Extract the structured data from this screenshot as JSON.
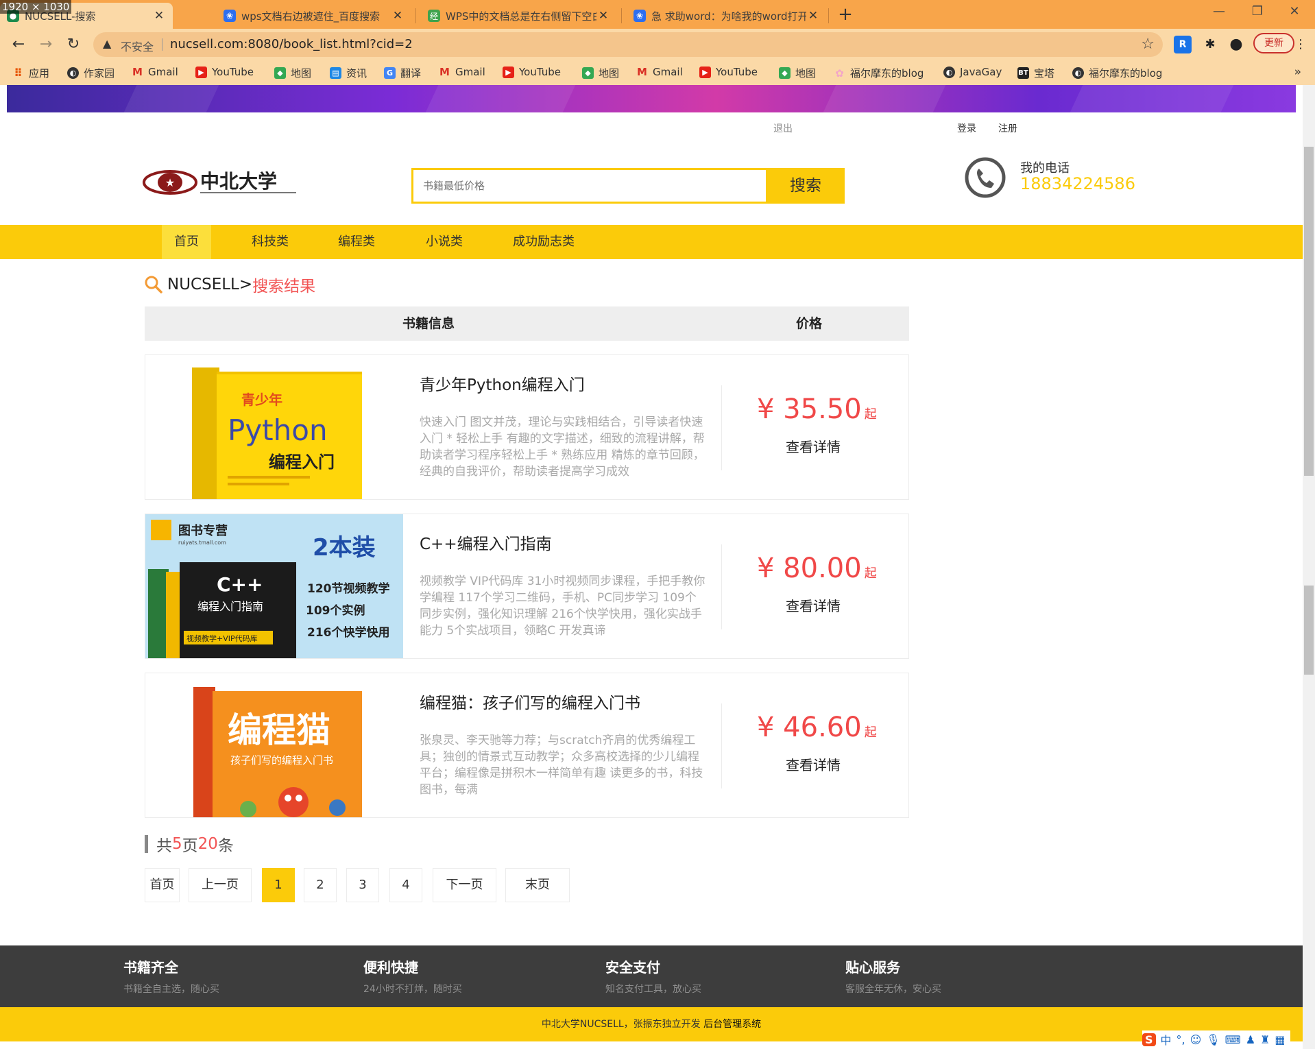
{
  "screen_label": "1920 × 1030",
  "browser": {
    "tabs": [
      {
        "title": "NUCSELL-搜索",
        "active": true,
        "icon": "page-icon"
      },
      {
        "title": "wps文档右边被遮住_百度搜索",
        "active": false,
        "icon": "baidu-paw-icon"
      },
      {
        "title": "WPS中的文档总是在右侧留下空白",
        "active": false,
        "icon": "baidu-jingyan-icon"
      },
      {
        "title": "急 求助word：为啥我的word打开",
        "active": false,
        "icon": "baidu-paw-icon"
      }
    ],
    "address": {
      "security_text": "不安全",
      "url": "nucsell.com:8080/book_list.html?cid=2"
    },
    "update_label": "更新",
    "bookmarks": [
      {
        "label": "应用",
        "icon": "apps-grid-icon"
      },
      {
        "label": "作家园",
        "icon": "globe-icon"
      },
      {
        "label": "Gmail",
        "icon": "gmail-icon"
      },
      {
        "label": "YouTube",
        "icon": "youtube-icon"
      },
      {
        "label": "地图",
        "icon": "maps-icon"
      },
      {
        "label": "资讯",
        "icon": "news-icon"
      },
      {
        "label": "翻译",
        "icon": "translate-icon"
      },
      {
        "label": "Gmail",
        "icon": "gmail-icon"
      },
      {
        "label": "YouTube",
        "icon": "youtube-icon"
      },
      {
        "label": "地图",
        "icon": "maps-icon"
      },
      {
        "label": "Gmail",
        "icon": "gmail-icon"
      },
      {
        "label": "YouTube",
        "icon": "youtube-icon"
      },
      {
        "label": "地图",
        "icon": "maps-icon"
      },
      {
        "label": "福尔摩东的blog",
        "icon": "flower-icon"
      },
      {
        "label": "JavaGay",
        "icon": "globe-icon"
      },
      {
        "label": "宝塔",
        "icon": "bt-icon"
      },
      {
        "label": "福尔摩东的blog",
        "icon": "globe-icon"
      }
    ],
    "bookmarks_more": "»"
  },
  "site": {
    "top_links": {
      "logout": "退出",
      "login": "登录",
      "register": "注册"
    },
    "logo_alt": "中北大学",
    "search": {
      "placeholder": "书籍最低价格",
      "button": "搜索"
    },
    "phone": {
      "label": "我的电话",
      "number": "18834224586"
    },
    "nav": [
      "首页",
      "科技类",
      "编程类",
      "小说类",
      "成功励志类"
    ],
    "nav_active": 0,
    "breadcrumb": {
      "root": "NUCSELL>",
      "current": "搜索结果"
    },
    "table_header": {
      "info": "书籍信息",
      "price": "价格"
    },
    "books": [
      {
        "title": "青少年Python编程入门",
        "description": "快速入门 图文并茂，理论与实践相结合，引导读者快速入门 * 轻松上手 有趣的文字描述，细致的流程讲解，帮助读者学习程序轻松上手 * 熟练应用 精炼的章节回顾，经典的自我评价，帮助读者提高学习成效",
        "price": "¥ 35.50",
        "price_suffix": "起",
        "detail": "查看详情",
        "cover": {
          "line1": "青少年",
          "line2": "Python",
          "line3": "编程入门"
        }
      },
      {
        "title": "C++编程入门指南",
        "description": "视频教学 VIP代码库 31小时视频同步课程，手把手教你学编程 117个学习二维码，手机、PC同步学习 109个同步实例，强化知识理解 216个快学快用，强化实战手能力 5个实战项目，领略C 开发真谛",
        "price": "¥ 80.00",
        "price_suffix": "起",
        "detail": "查看详情",
        "cover": {
          "brand": "图书专营",
          "site": "ruiyats.tmall.com",
          "badge": "2本装",
          "book": "C++",
          "book_sub": "编程入门指南",
          "f1": "120节视频教学",
          "f2": "109个实例",
          "f3": "216个快学快用",
          "strip": "视频教学+VIP代码库"
        }
      },
      {
        "title": "编程猫：孩子们写的编程入门书",
        "description": "张泉灵、李天驰等力荐；与scratch齐肩的优秀编程工具；独创的情景式互动教学；众多高校选择的少儿编程平台；编程像是拼积木一样简单有趣 读更多的书，科技图书，每满",
        "price": "¥ 46.60",
        "price_suffix": "起",
        "detail": "查看详情",
        "cover": {
          "line1": "编程猫",
          "line2": "孩子们写的编程入门书"
        }
      }
    ],
    "summary": {
      "prefix": "共 ",
      "pages": "5",
      "mid": "页",
      "count": "20",
      "suffix": "条"
    },
    "pagination": {
      "first": "首页",
      "prev": "上一页",
      "pages": [
        "1",
        "2",
        "3",
        "4"
      ],
      "current": "1",
      "next": "下一页",
      "last": "末页"
    },
    "footer": {
      "features": [
        {
          "title": "书籍齐全",
          "subtitle": "书籍全自主选，随心买"
        },
        {
          "title": "便利快捷",
          "subtitle": "24小时不打烊，随时买"
        },
        {
          "title": "安全支付",
          "subtitle": "知名支付工具，放心买"
        },
        {
          "title": "贴心服务",
          "subtitle": "客服全年无休，安心买"
        }
      ],
      "copyright": "中北大学NUCSELL，张振东独立开发 ",
      "admin_link": "后台管理系统"
    },
    "ime": {
      "logo": "S",
      "mode": "中",
      "punct": "°,"
    }
  },
  "colors": {
    "tabbar": "#f8a54a",
    "toolbar": "#fbd9a7",
    "brand_yellow": "#fbcb0a",
    "price_red": "#f04848",
    "footer_dark": "#3d3d3d"
  }
}
